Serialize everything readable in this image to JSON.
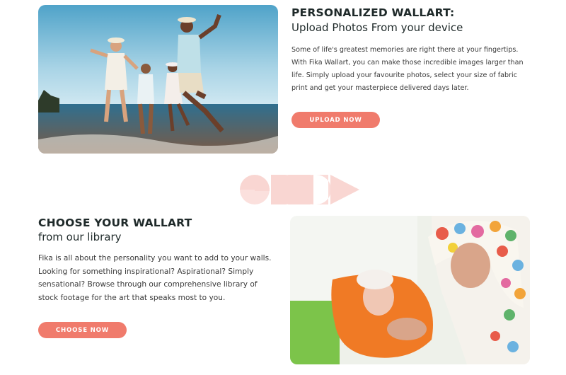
{
  "section_upload": {
    "title": "PERSONALIZED WALLART:",
    "subtitle": "Upload Photos From your device",
    "body": "Some of life's greatest memories are right there at your fingertips. With Fika Wallart, you can make those incredible images larger than life. Simply upload your favourite photos, select your size of fabric print and get your masterpiece delivered days later.",
    "button_label": "UPLOAD NOW"
  },
  "section_library": {
    "title": "CHOOSE YOUR WALLART",
    "subtitle": "from our library",
    "body": "Fika is all about the personality you want to add to your walls. Looking for something inspirational? Aspirational? Simply sensational? Browse through our comprehensive library of stock footage for the art that speaks most to you.",
    "button_label": "CHOOSE NOW"
  },
  "colors": {
    "accent": "#f07b6c",
    "divider_logo": "#f9d6d2",
    "heading": "#1f2a2a"
  },
  "icons": {
    "divider": "decorative-geometric-logo-icon"
  }
}
